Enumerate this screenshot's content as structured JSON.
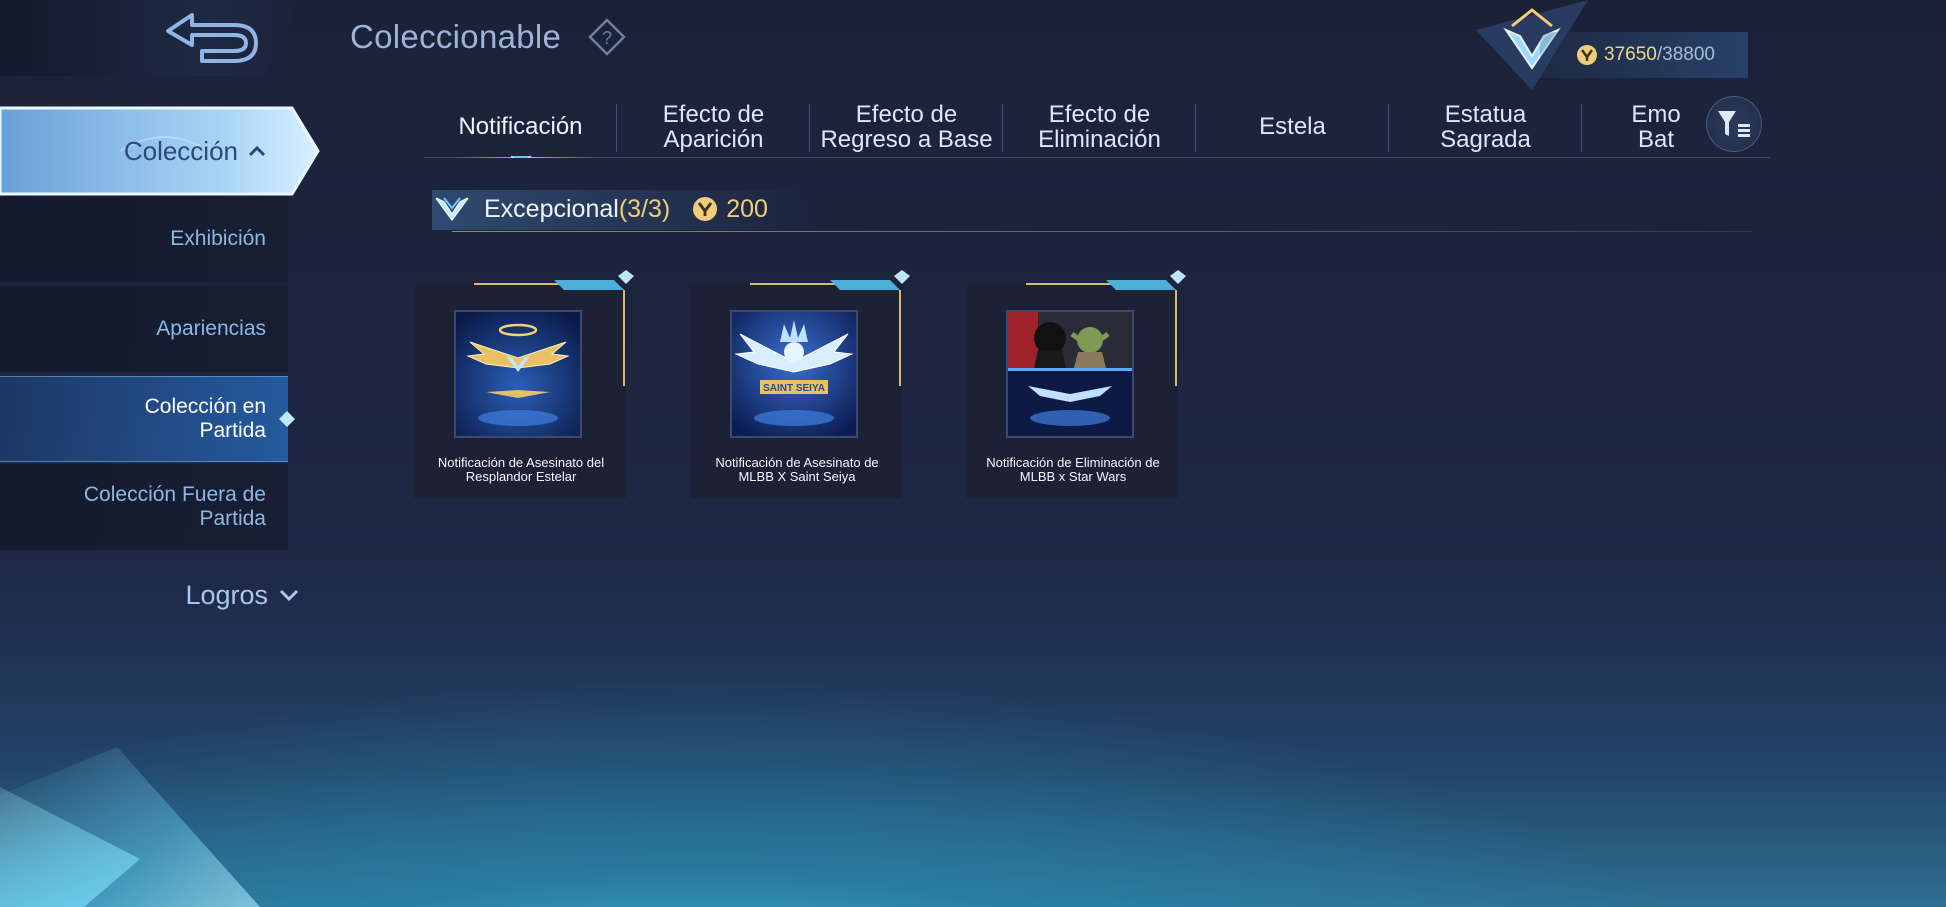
{
  "header": {
    "title": "Coleccionable",
    "points_current": "37650",
    "points_max": "/38800"
  },
  "sidebar": {
    "section": "Colección",
    "items": [
      {
        "label": "Exhibición"
      },
      {
        "label": "Apariencias"
      },
      {
        "label": "Colección en Partida",
        "selected": true
      },
      {
        "label": "Colección Fuera de Partida"
      }
    ],
    "footer": "Logros"
  },
  "tabs": [
    {
      "label": "Notificación",
      "active": true
    },
    {
      "label": "Efecto de Aparición"
    },
    {
      "label": "Efecto de Regreso a Base"
    },
    {
      "label": "Efecto de Eliminación"
    },
    {
      "label": "Estela"
    },
    {
      "label": "Estatua Sagrada"
    },
    {
      "label": "Emo Bat"
    }
  ],
  "rarity": {
    "label": "Excepcional",
    "count": "(3/3)",
    "cost": "200"
  },
  "cards": [
    {
      "name": "Notificación de Asesinato del Resplandor Estelar"
    },
    {
      "name": "Notificación de Asesinato de MLBB X Saint Seiya"
    },
    {
      "name": "Notificación de Eliminación de MLBB x Star Wars"
    }
  ],
  "colors": {
    "accent_gold": "#d9b872",
    "accent_blue": "#4aa3e6",
    "bg_dark": "#1b2238"
  }
}
